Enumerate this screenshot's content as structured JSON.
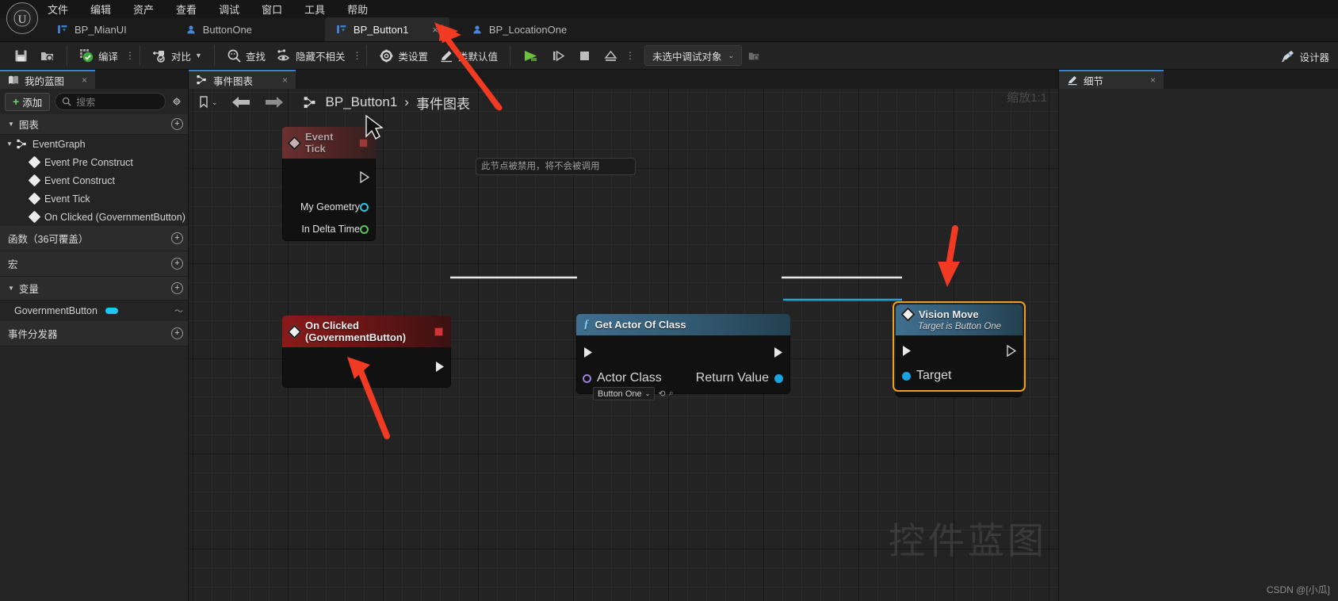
{
  "app": {
    "logo": "unreal-engine-logo",
    "menu": [
      "文件",
      "编辑",
      "资产",
      "查看",
      "调试",
      "窗口",
      "工具",
      "帮助"
    ]
  },
  "tabs": [
    {
      "label": "BP_MianUI",
      "icon": "widget-blueprint-icon",
      "active": false
    },
    {
      "label": "ButtonOne",
      "icon": "blueprint-class-icon",
      "active": false
    },
    {
      "label": "BP_Button1",
      "icon": "widget-blueprint-icon",
      "active": true,
      "close": "×"
    },
    {
      "label": "BP_LocationOne",
      "icon": "blueprint-class-icon",
      "active": false
    }
  ],
  "toolbar": {
    "save_icon": "save-icon",
    "browse_icon": "browse-content-icon",
    "compile_label": "编译",
    "compile_icon": "compile-icon",
    "diff_label": "对比",
    "diff_icon": "diff-icon",
    "find_label": "查找",
    "find_icon": "search-icon",
    "hide_unrelated_label": "隐藏不相关",
    "hide_unrelated_icon": "hide-unrelated-icon",
    "class_settings_label": "类设置",
    "class_settings_icon": "gear-icon",
    "class_defaults_label": "类默认值",
    "class_defaults_icon": "pencil-icon",
    "play_icon": "play-icon",
    "step_icon": "step-icon",
    "stop_icon": "stop-icon",
    "eject_icon": "eject-icon",
    "overflow_icon": "kebab-menu-icon",
    "debug_object": "未选中调试对象",
    "debug_browse_icon": "browse-debug-icon",
    "designer_label": "设计器",
    "designer_icon": "designer-icon"
  },
  "my_blueprint": {
    "tab_label": "我的蓝图",
    "tab_icon": "blueprint-book-icon",
    "tab_close": "×",
    "add_label": "添加",
    "search_placeholder": "搜索",
    "settings_icon": "gear-icon",
    "sections": [
      {
        "label": "图表",
        "expanded": true
      },
      {
        "label": "函数（36可覆盖）",
        "expanded": false
      },
      {
        "label": "宏",
        "expanded": false
      },
      {
        "label": "变量",
        "expanded": true
      },
      {
        "label": "事件分发器",
        "expanded": false
      }
    ],
    "graph_root": "EventGraph",
    "events": [
      "Event Pre Construct",
      "Event Construct",
      "Event Tick",
      "On Clicked (GovernmentButton)"
    ],
    "variables": [
      {
        "name": "GovernmentButton",
        "type_color": "#19c8f0"
      }
    ]
  },
  "details": {
    "tab_label": "细节",
    "tab_icon": "details-icon",
    "tab_close": "×"
  },
  "graph": {
    "tab_label": "事件图表",
    "tab_icon": "event-graph-icon",
    "tab_close": "×",
    "breadcrumb": [
      "BP_Button1",
      "事件图表"
    ],
    "breadcrumb_sep": "›",
    "zoom_label": "缩放1:1",
    "watermark": "控件蓝图",
    "tooltip": "此节点被禁用，将不会被调用",
    "back_icon": "arrow-left-icon",
    "forward_icon": "arrow-right-icon",
    "bookmark_icon": "bookmark-icon"
  },
  "nodes": {
    "event_tick": {
      "title": "Event Tick",
      "disabled": true,
      "out_pins": [
        "My Geometry",
        "In Delta Time"
      ]
    },
    "on_clicked": {
      "title": "On Clicked (GovernmentButton)"
    },
    "get_actor_of_class": {
      "title": "Get Actor Of Class",
      "input_pin": "Actor Class",
      "input_value": "Button One",
      "output_pin": "Return Value"
    },
    "vision_move": {
      "title": "Vision Move",
      "subtitle": "Target is Button One",
      "target_pin": "Target",
      "selected": true,
      "selection_color": "#f0a020"
    }
  },
  "watermark_credit": "CSDN @[小瓜]"
}
